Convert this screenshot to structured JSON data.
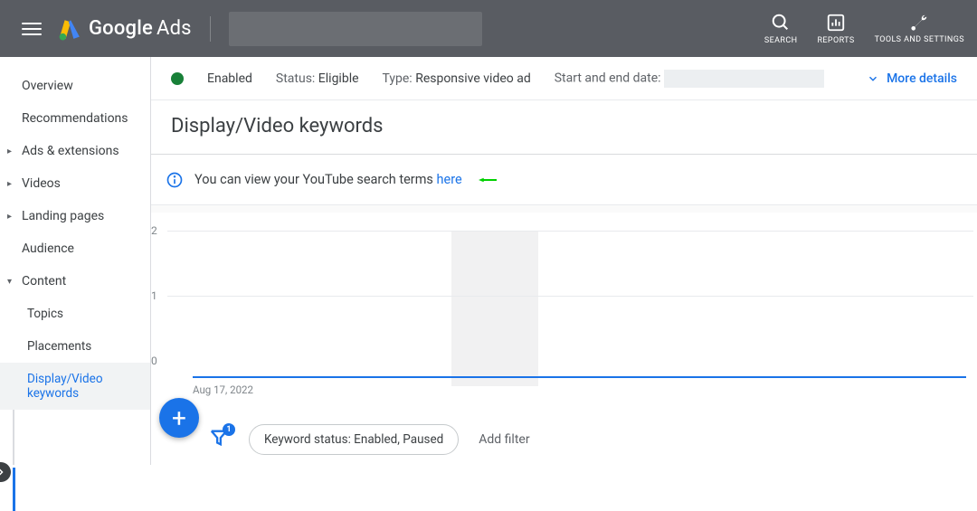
{
  "app": {
    "name_primary": "Google",
    "name_secondary": "Ads"
  },
  "header": {
    "search": "SEARCH",
    "reports": "REPORTS",
    "tools": "TOOLS AND SETTINGS"
  },
  "sidebar": {
    "items": [
      {
        "label": "Overview"
      },
      {
        "label": "Recommendations"
      },
      {
        "label": "Ads & extensions"
      },
      {
        "label": "Videos"
      },
      {
        "label": "Landing pages"
      },
      {
        "label": "Audience"
      },
      {
        "label": "Content"
      },
      {
        "label": "Topics"
      },
      {
        "label": "Placements"
      },
      {
        "label": "Display/Video keywords"
      }
    ]
  },
  "status": {
    "enabled": "Enabled",
    "status_label": "Status:",
    "status_value": "Eligible",
    "type_label": "Type:",
    "type_value": "Responsive video ad",
    "date_label": "Start and end date:",
    "more": "More details"
  },
  "page": {
    "title": "Display/Video keywords"
  },
  "notice": {
    "text": "You can view your YouTube search terms ",
    "link": "here"
  },
  "chart_data": {
    "type": "line",
    "title": "",
    "xlabel": "",
    "ylabel": "",
    "ylim": [
      0,
      2
    ],
    "yticks": [
      0,
      1,
      2
    ],
    "x_start_label": "Aug 17, 2022",
    "series": [
      {
        "name": "",
        "values": [
          0
        ]
      }
    ]
  },
  "filters": {
    "chip": "Keyword status: Enabled, Paused",
    "add": "Add filter",
    "funnel_badge": "1"
  }
}
